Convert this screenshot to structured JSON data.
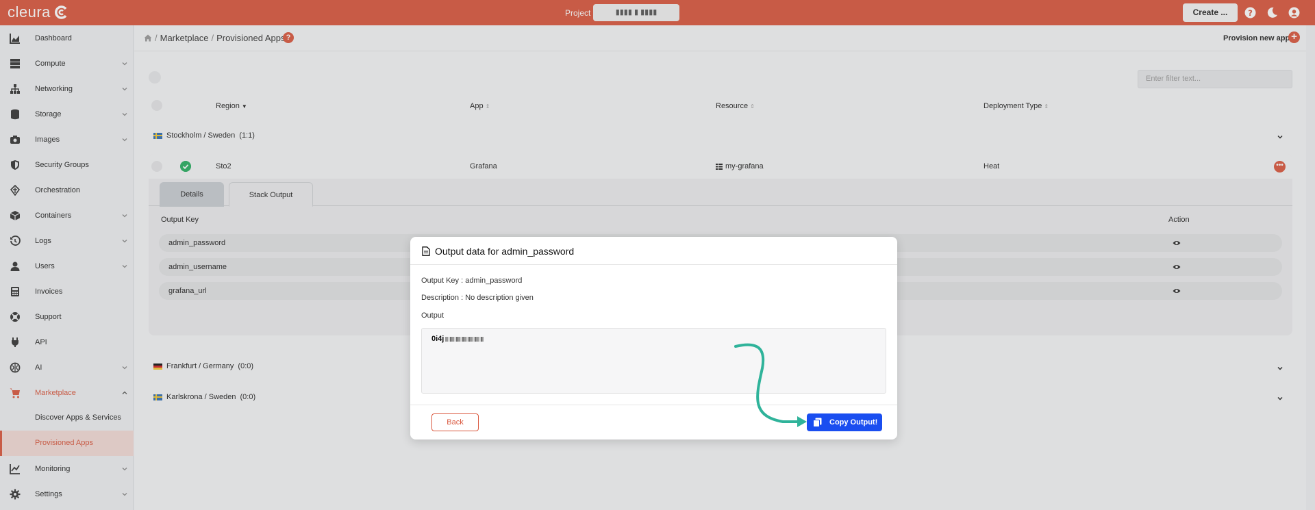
{
  "topbar": {
    "logo": "cleura",
    "project_label": "Project",
    "project_value": "▮▮▮▮ ▮ ▮▮▮▮",
    "create_label": "Create ...",
    "icons": [
      "help-icon",
      "moon-icon",
      "user-icon"
    ]
  },
  "sidebar": {
    "items": [
      {
        "label": "Dashboard",
        "icon": "chart-icon"
      },
      {
        "label": "Compute",
        "icon": "server-icon"
      },
      {
        "label": "Networking",
        "icon": "network-icon"
      },
      {
        "label": "Storage",
        "icon": "database-icon"
      },
      {
        "label": "Images",
        "icon": "camera-icon"
      },
      {
        "label": "Security Groups",
        "icon": "shield-icon"
      },
      {
        "label": "Orchestration",
        "icon": "orchestration-icon"
      },
      {
        "label": "Containers",
        "icon": "cube-icon"
      },
      {
        "label": "Logs",
        "icon": "history-icon"
      },
      {
        "label": "Users",
        "icon": "user-icon"
      },
      {
        "label": "Invoices",
        "icon": "calculator-icon"
      },
      {
        "label": "Support",
        "icon": "lifebuoy-icon"
      },
      {
        "label": "API",
        "icon": "plug-icon"
      },
      {
        "label": "AI",
        "icon": "brain-icon"
      },
      {
        "label": "Marketplace",
        "icon": "cart-icon"
      },
      {
        "label": "Monitoring",
        "icon": "chart-line-icon"
      },
      {
        "label": "Settings",
        "icon": "gear-icon"
      }
    ],
    "marketplace_sub": [
      {
        "label": "Discover Apps & Services"
      },
      {
        "label": "Provisioned Apps"
      }
    ]
  },
  "header": {
    "breadcrumb": [
      "Marketplace",
      "Provisioned Apps"
    ],
    "help": "?",
    "provision_label": "Provision new app"
  },
  "table": {
    "filter_placeholder": "Enter filter text...",
    "columns": [
      "Region",
      "App",
      "Resource",
      "Deployment Type"
    ],
    "groups": [
      {
        "name": "Stockholm / Sweden",
        "count": "(1:1)"
      },
      {
        "name": "Frankfurt / Germany",
        "count": "(0:0)"
      },
      {
        "name": "Karlskrona / Sweden",
        "count": "(0:0)"
      }
    ],
    "row": {
      "region": "Sto2",
      "app": "Grafana",
      "resource": "my-grafana",
      "deployment": "Heat"
    },
    "tabs": [
      "Details",
      "Stack Output"
    ],
    "output_headers": {
      "key": "Output Key",
      "action": "Action"
    },
    "outputs": [
      "admin_password",
      "admin_username",
      "grafana_url"
    ]
  },
  "modal": {
    "title": "Output data for admin_password",
    "output_key_line": "Output Key : admin_password",
    "description_line": "Description : No description given",
    "output_label": "Output",
    "output_value_prefix": "0i4j",
    "back_label": "Back",
    "copy_label": "Copy Output!"
  },
  "colors": {
    "brand": "#d9553b",
    "primary": "#1a4ef0",
    "success": "#27ae60",
    "arrow": "#2fb39a"
  }
}
